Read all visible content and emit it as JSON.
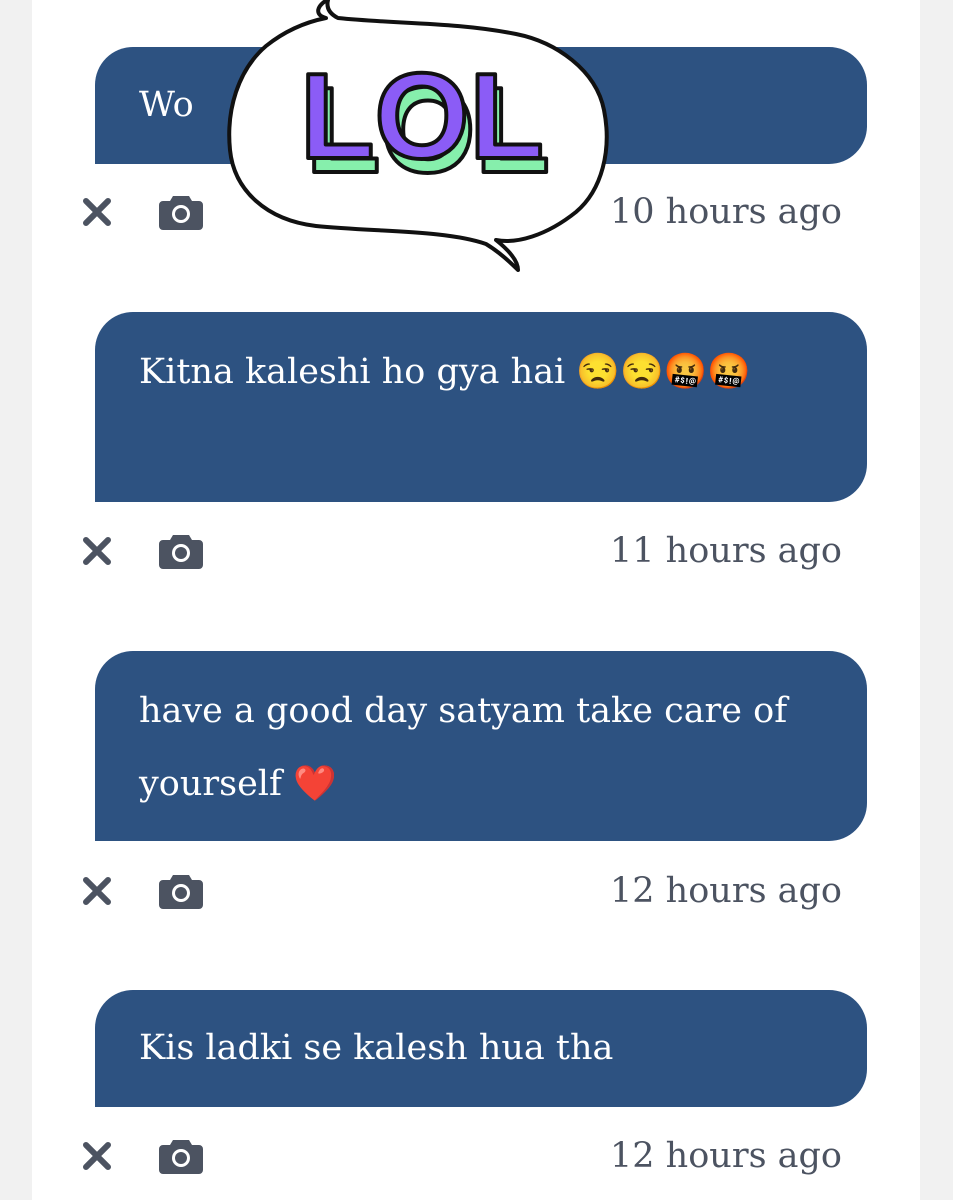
{
  "messages": [
    {
      "text": "Wo",
      "time": "10 hours ago"
    },
    {
      "text": "Kitna kaleshi ho gya hai 😒😒🤬🤬",
      "time": "11 hours ago"
    },
    {
      "text": "have a good day satyam take care of yourself ❤️",
      "time": "12 hours ago"
    },
    {
      "text": "Kis ladki se kalesh hua tha",
      "time": "12 hours ago"
    }
  ],
  "sticker": {
    "text": "LOL"
  },
  "colors": {
    "bubble": "#2d5281",
    "icon": "#4c5361",
    "sticker_fill": "#8b5cf6",
    "sticker_shadow": "#86efac"
  },
  "icons": {
    "delete": "close-icon",
    "screenshot": "camera-icon"
  }
}
